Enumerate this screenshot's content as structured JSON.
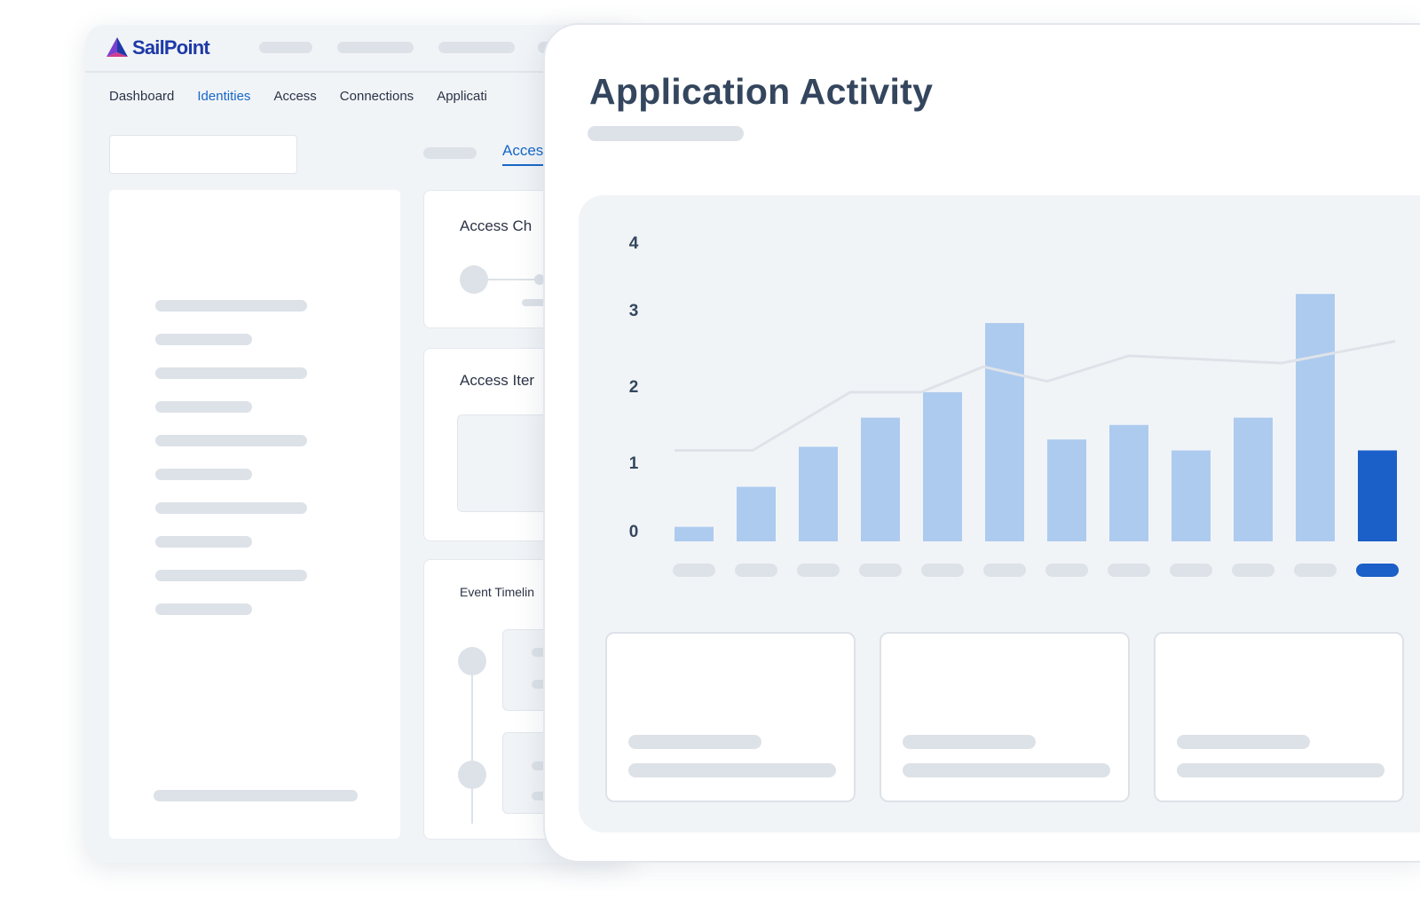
{
  "brand": {
    "name": "SailPoint",
    "logo_icon": "sailpoint-pyramid-icon"
  },
  "nav": {
    "items": [
      "Dashboard",
      "Identities",
      "Access",
      "Connections",
      "Applicati"
    ],
    "active_index": 1
  },
  "tabs": {
    "active_label": "Acces"
  },
  "cards": {
    "access_changes": "Access Ch",
    "access_items": "Access Iter",
    "event_timeline": "Event Timelin"
  },
  "colors": {
    "brand": "#1e3aa8",
    "accent": "#1767c7",
    "bar": "#adcbef",
    "bar_highlight": "#1b5fc8",
    "trend": "#dfe3e9"
  },
  "front": {
    "title": "Application Activity"
  },
  "chart_data": {
    "type": "bar",
    "title": "Application Activity",
    "y_ticks": [
      "0",
      "1",
      "2",
      "3",
      "4"
    ],
    "ylim": [
      0,
      4
    ],
    "values": [
      0.2,
      0.75,
      1.3,
      1.7,
      2.05,
      3.0,
      1.4,
      1.6,
      1.25,
      1.7,
      3.4,
      1.25
    ],
    "highlight_index": 11,
    "trend": [
      1.25,
      2.05,
      2.05,
      2.4,
      2.2,
      2.55,
      2.45,
      2.75
    ],
    "grid": false
  }
}
